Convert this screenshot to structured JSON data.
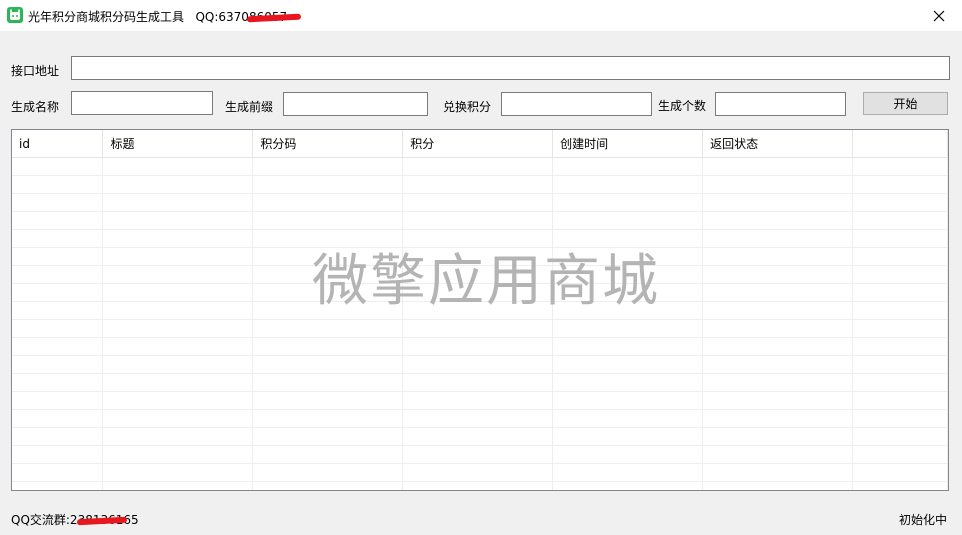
{
  "window": {
    "title": "光年积分商城积分码生成工具",
    "qq_label": "QQ:637086057",
    "icon": "app-icon",
    "close_icon": "close-icon"
  },
  "form": {
    "api_label": "接口地址",
    "api_value": "",
    "name_label": "生成名称",
    "name_value": "",
    "prefix_label": "生成前缀",
    "prefix_value": "",
    "points_label": "兑换积分",
    "points_value": "",
    "count_label": "生成个数",
    "count_value": "",
    "start_button": "开始"
  },
  "table": {
    "columns": [
      "id",
      "标题",
      "积分码",
      "积分",
      "创建时间",
      "返回状态"
    ],
    "rows": []
  },
  "watermark": "微擎应用商城",
  "status": {
    "qq_group": "QQ交流群:238136165",
    "state": "初始化中"
  },
  "colors": {
    "app_icon": "#2fb35b",
    "redaction": "#e8161e",
    "watermark": "#b4b4b4"
  }
}
